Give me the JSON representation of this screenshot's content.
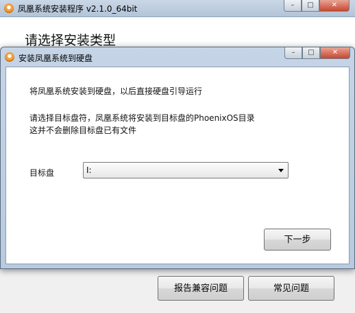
{
  "main_window": {
    "title": "凤凰系统安装程序 v2.1.0_64bit",
    "heading": "请选择安装类型",
    "buttons": {
      "report": "报告兼容问题",
      "faq": "常见问题"
    }
  },
  "dialog": {
    "title": "安装凤凰系统到硬盘",
    "line1": "将凤凰系统安装到硬盘，以后直接硬盘引导运行",
    "line2": "请选择目标盘符，凤凰系统将安装到目标盘的PhoenixOS目录",
    "line3": "这并不会删除目标盘已有文件",
    "target_label": "目标盘",
    "target_value": "I:",
    "next_button": "下一步"
  },
  "caption": {
    "minimize": "–",
    "maximize": "□",
    "close": "✕"
  }
}
